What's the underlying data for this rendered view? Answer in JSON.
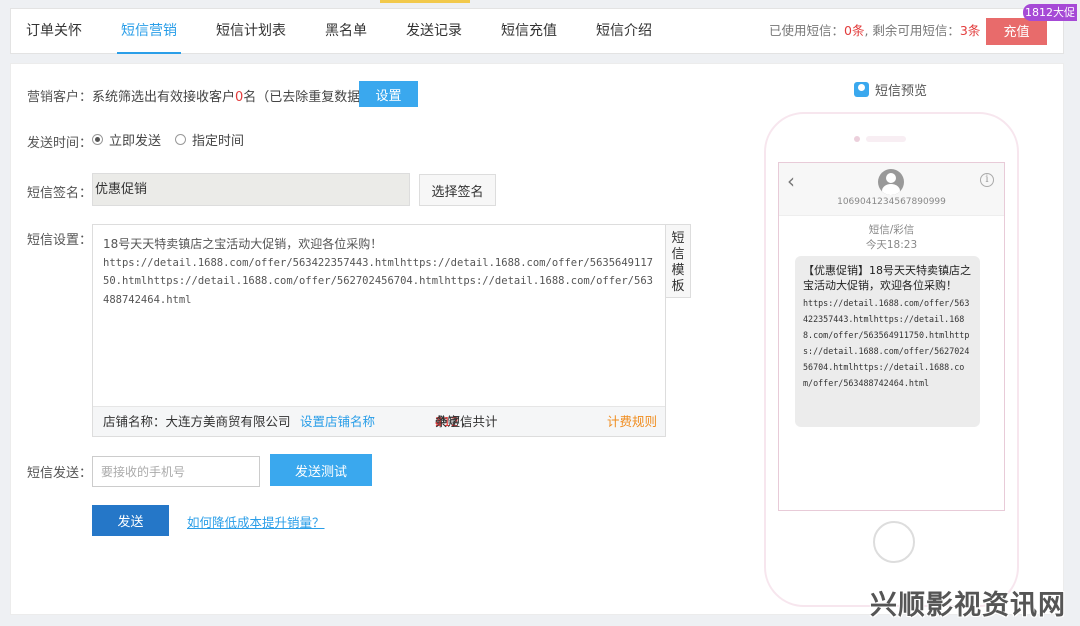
{
  "tabs": [
    {
      "label": "订单关怀",
      "active": false
    },
    {
      "label": "短信营销",
      "active": true
    },
    {
      "label": "短信计划表",
      "active": false
    },
    {
      "label": "黑名单",
      "active": false
    },
    {
      "label": "发送记录",
      "active": false
    },
    {
      "label": "短信充值",
      "active": false
    },
    {
      "label": "短信介绍",
      "active": false
    }
  ],
  "usage": {
    "prefix": "已使用短信：",
    "used": "0条",
    "middle": ", 剩余可用短信：",
    "remaining": "3条"
  },
  "recharge_label": "充值",
  "badge": "1812大促",
  "form": {
    "customer_label": "营销客户：",
    "customer_text_a": "系统筛选出有效接收客户",
    "customer_count": "0",
    "customer_text_b": "名（已去除重复数据）",
    "setup_button": "设置",
    "time_label": "发送时间：",
    "radio_now": "立即发送",
    "radio_scheduled": "指定时间",
    "signature_label": "短信签名：",
    "signature_value": "优惠促销",
    "choose_signature": "选择签名",
    "settings_label": "短信设置：",
    "message_first_line": "18号天天特卖镇店之宝活动大促销，欢迎各位采购！",
    "message_urls": "https://detail.1688.com/offer/563422357443.htmlhttps://detail.1688.com/offer/563564911750.htmlhttps://detail.1688.com/offer/562702456704.htmlhttps://detail.1688.com/offer/563488742464.html",
    "template_button": "短信模板",
    "shop_name": "店铺名称：大连方美商贸有限公司",
    "set_shop_name": "设置店铺名称",
    "count_a": "共",
    "char_count": "212",
    "count_b": "个字，共计",
    "msg_count": "4",
    "count_c": "条短信",
    "billing_rules": "计费规则",
    "send_label": "短信发送：",
    "phone_placeholder": "要接收的手机号",
    "test_button": "发送测试",
    "send_button": "发送",
    "help_link": "如何降低成本提升销量？"
  },
  "preview": {
    "title": "短信预览",
    "sender_number": "1069041234567890999",
    "msg_type": "短信/彩信",
    "msg_time": "今天18:23",
    "bubble_head": "【优惠促销】18号天天特卖镇店之宝活动大促销，欢迎各位采购！",
    "bubble_urls": "https://detail.1688.com/offer/563422357443.htmlhttps://detail.1688.com/offer/563564911750.htmlhttps://detail.1688.com/offer/562702456704.htmlhttps://detail.1688.com/offer/563488742464.html"
  },
  "watermark": "兴顺影视资讯网",
  "colors": {
    "accent": "#2a9ee8",
    "danger": "#e23c3c",
    "recharge": "#e86b6b",
    "badge": "#a64ad6",
    "send": "#2577c8"
  }
}
